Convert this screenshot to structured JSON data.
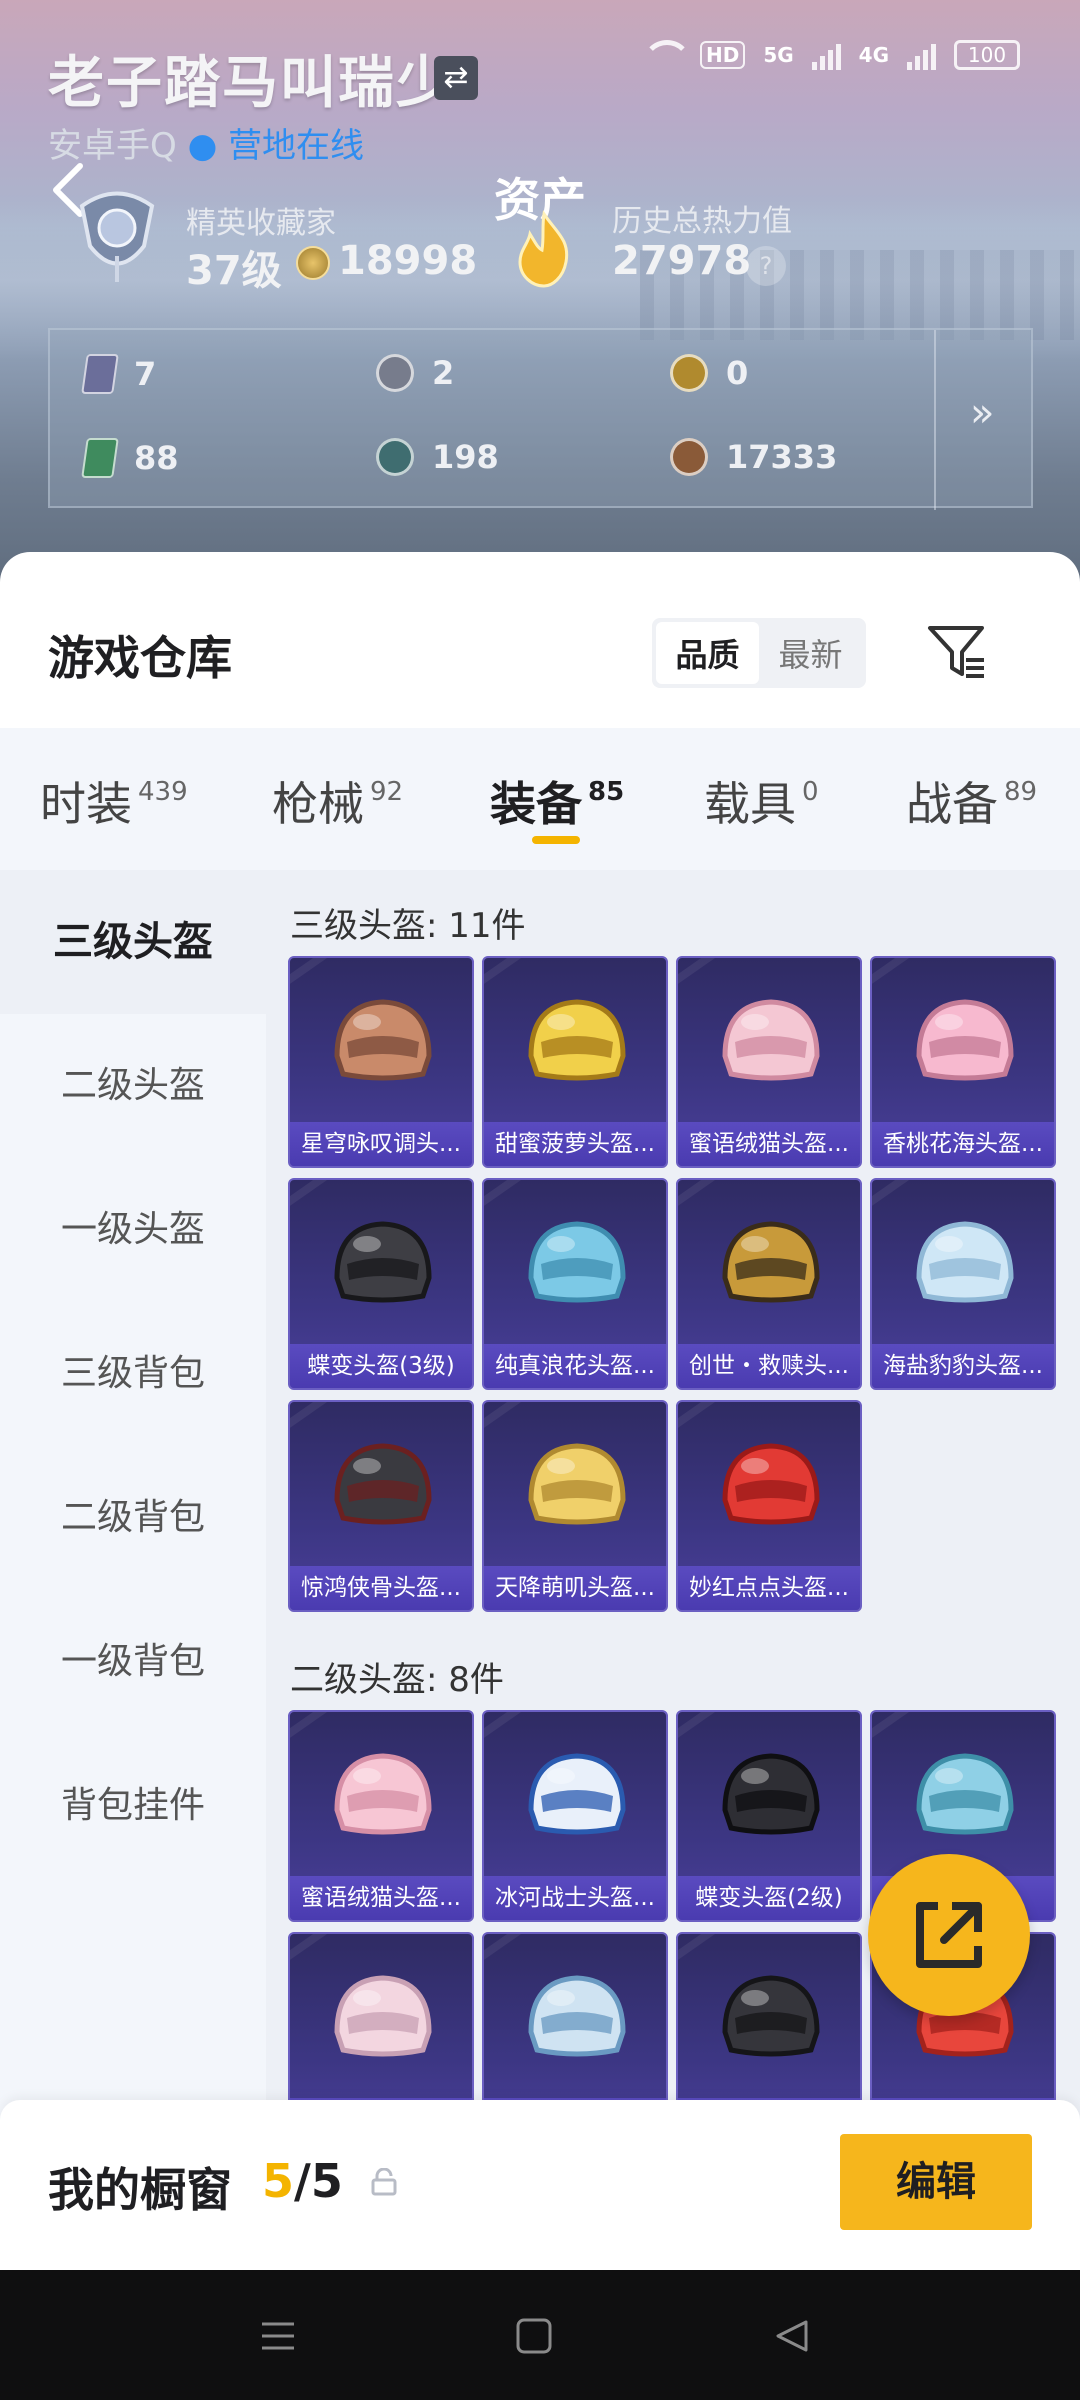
{
  "status_bar": {
    "badge_hd": "HD",
    "net1": "5G",
    "net2": "4G",
    "battery": "100"
  },
  "profile": {
    "name": "老子踏马叫瑞少",
    "platform": "安卓手Q",
    "dot": "●",
    "online_status": "营地在线",
    "rank_title": "精英收藏家",
    "rank_level": "37级",
    "rank_score": "18998",
    "assets_label": "资产",
    "heat_title": "历史总热力值",
    "heat_value": "27978",
    "help": "?"
  },
  "currencies": [
    {
      "icon": "purple-card-icon",
      "value": "7"
    },
    {
      "icon": "silver-coin-icon",
      "value": "2"
    },
    {
      "icon": "gold-coin-icon",
      "value": "0"
    },
    {
      "icon": "green-card-icon",
      "value": "88"
    },
    {
      "icon": "teal-coin-icon",
      "value": "198"
    },
    {
      "icon": "bronze-coin-icon",
      "value": "17333"
    }
  ],
  "warehouse": {
    "title": "游戏仓库",
    "sort_quality": "品质",
    "sort_newest": "最新",
    "tabs": [
      {
        "label": "时装",
        "count": "439"
      },
      {
        "label": "枪械",
        "count": "92"
      },
      {
        "label": "装备",
        "count": "85"
      },
      {
        "label": "载具",
        "count": "0"
      },
      {
        "label": "战备",
        "count": "89"
      }
    ],
    "side_nav": [
      "三级头盔",
      "二级头盔",
      "一级头盔",
      "三级背包",
      "二级背包",
      "一级背包",
      "背包挂件"
    ],
    "sections": [
      {
        "heading": "三级头盔: 11件",
        "items": [
          "星穹咏叹调头...",
          "甜蜜菠萝头盔...",
          "蜜语绒猫头盔...",
          "香桃花海头盔...",
          "蝶变头盔(3级)",
          "纯真浪花头盔...",
          "创世・救赎头...",
          "海盐豹豹头盔...",
          "惊鸿侠骨头盔...",
          "天降萌叽头盔...",
          "妙红点点头盔..."
        ]
      },
      {
        "heading": "二级头盔: 8件",
        "items": [
          "蜜语绒猫头盔...",
          "冰河战士头盔...",
          "蝶变头盔(2级)",
          "",
          "",
          "",
          "",
          ""
        ]
      }
    ]
  },
  "showcase": {
    "title": "我的橱窗",
    "current": "5",
    "separator": "/",
    "total": "5",
    "edit_label": "编辑"
  },
  "colors": {
    "accent": "#f6b61c",
    "card_bg": "#3c3683",
    "online": "#2f8ef0"
  }
}
